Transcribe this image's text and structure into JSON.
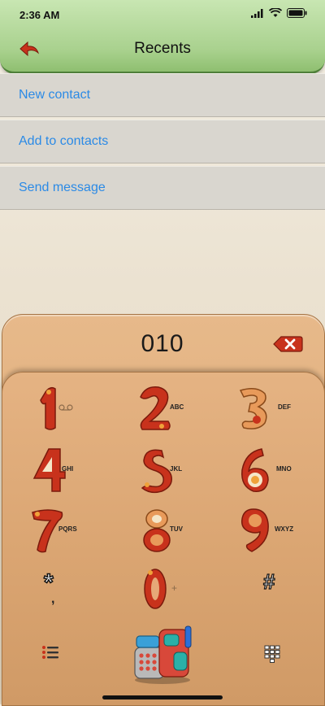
{
  "status": {
    "time": "2:36 AM"
  },
  "header": {
    "title": "Recents"
  },
  "menu": [
    {
      "label": "New contact"
    },
    {
      "label": "Add to contacts"
    },
    {
      "label": "Send message"
    }
  ],
  "dialer": {
    "number": "010",
    "keys": [
      {
        "digit": "1",
        "sub": ""
      },
      {
        "digit": "2",
        "sub": "ABC"
      },
      {
        "digit": "3",
        "sub": "DEF"
      },
      {
        "digit": "4",
        "sub": "GHI"
      },
      {
        "digit": "5",
        "sub": "JKL"
      },
      {
        "digit": "6",
        "sub": "MNO"
      },
      {
        "digit": "7",
        "sub": "PQRS"
      },
      {
        "digit": "8",
        "sub": "TUV"
      },
      {
        "digit": "9",
        "sub": "WXYZ"
      },
      {
        "digit": "*",
        "sub": ","
      },
      {
        "digit": "0",
        "sub": "+"
      },
      {
        "digit": "#",
        "sub": ""
      }
    ]
  },
  "icons": {
    "back": "back-arrow-icon",
    "delete": "backspace-icon",
    "voicemail": "voicemail-icon",
    "menu": "list-menu-icon",
    "call": "clay-phone-icon",
    "keypad": "keypad-grid-icon"
  },
  "colors": {
    "link": "#2b8ae6",
    "header": "#a9d18e",
    "clay_red": "#c8321c",
    "panel": "#dba673"
  }
}
